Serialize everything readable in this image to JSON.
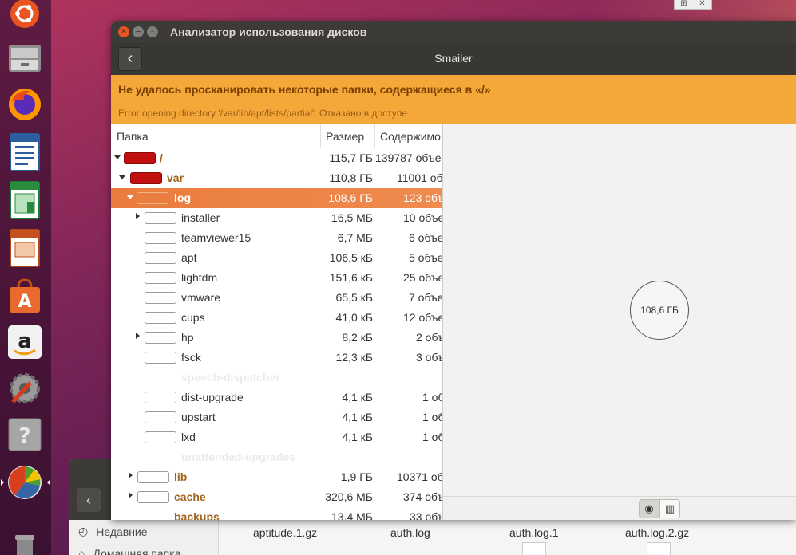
{
  "window": {
    "title": "Анализатор использования дисков",
    "header_title": "Smailer"
  },
  "infobar": {
    "title": "Не удалось просканировать некоторые папки, содержащиеся в «/»",
    "detail": "Error opening directory '/var/lib/apt/lists/partial': Отказано в доступе"
  },
  "columns": {
    "folder": "Папка",
    "size": "Размер",
    "contents": "Содержимо"
  },
  "rows": [
    {
      "name": "/",
      "size": "115,7 ГБ",
      "contents": "139787 объе"
    },
    {
      "name": "var",
      "size": "110,8 ГБ",
      "contents": "11001 объ"
    },
    {
      "name": "log",
      "size": "108,6 ГБ",
      "contents": "123 объ"
    },
    {
      "name": "installer",
      "size": "16,5 МБ",
      "contents": "10 объе"
    },
    {
      "name": "teamviewer15",
      "size": "6,7 МБ",
      "contents": "6 объе"
    },
    {
      "name": "apt",
      "size": "106,5 кБ",
      "contents": "5 объе"
    },
    {
      "name": "lightdm",
      "size": "151,6 кБ",
      "contents": "25 объе"
    },
    {
      "name": "vmware",
      "size": "65,5 кБ",
      "contents": "7 объе"
    },
    {
      "name": "cups",
      "size": "41,0 кБ",
      "contents": "12 объе"
    },
    {
      "name": "hp",
      "size": "8,2 кБ",
      "contents": "2 объ"
    },
    {
      "name": "fsck",
      "size": "12,3 кБ",
      "contents": "3 объ"
    },
    {
      "name": "speech-dispatcher",
      "size": "",
      "contents": ""
    },
    {
      "name": "dist-upgrade",
      "size": "4,1 кБ",
      "contents": "1 об"
    },
    {
      "name": "upstart",
      "size": "4,1 кБ",
      "contents": "1 об"
    },
    {
      "name": "lxd",
      "size": "4,1 кБ",
      "contents": "1 об"
    },
    {
      "name": "unattended-upgrades",
      "size": "",
      "contents": ""
    },
    {
      "name": "lib",
      "size": "1,9 ГБ",
      "contents": "10371 об"
    },
    {
      "name": "cache",
      "size": "320,6 МБ",
      "contents": "374 объ"
    },
    {
      "name": "backups",
      "size": "13,4 МБ",
      "contents": "33 объ"
    }
  ],
  "chart": {
    "center_label": "108,6 ГБ"
  },
  "file_manager": {
    "sidebar": [
      "Недавние",
      "Домашняя папка"
    ],
    "files": [
      "aptitude.1.gz",
      "auth.log",
      "auth.log.1",
      "auth.log.2.gz"
    ]
  },
  "launcher": [
    {
      "icon": "ubuntu-logo-icon"
    },
    {
      "icon": "files-icon"
    },
    {
      "icon": "firefox-icon"
    },
    {
      "icon": "writer-icon"
    },
    {
      "icon": "calc-icon"
    },
    {
      "icon": "impress-icon"
    },
    {
      "icon": "software-center-icon"
    },
    {
      "icon": "amazon-icon"
    },
    {
      "icon": "system-settings-icon"
    },
    {
      "icon": "help-icon"
    },
    {
      "icon": "disk-usage-analyzer-icon"
    },
    {
      "icon": "trash-icon"
    }
  ],
  "colors": {
    "accent": "#e95420",
    "selection": "#ee8346",
    "infobar": "#f4a83a",
    "bar_red": "#c10f0f"
  }
}
